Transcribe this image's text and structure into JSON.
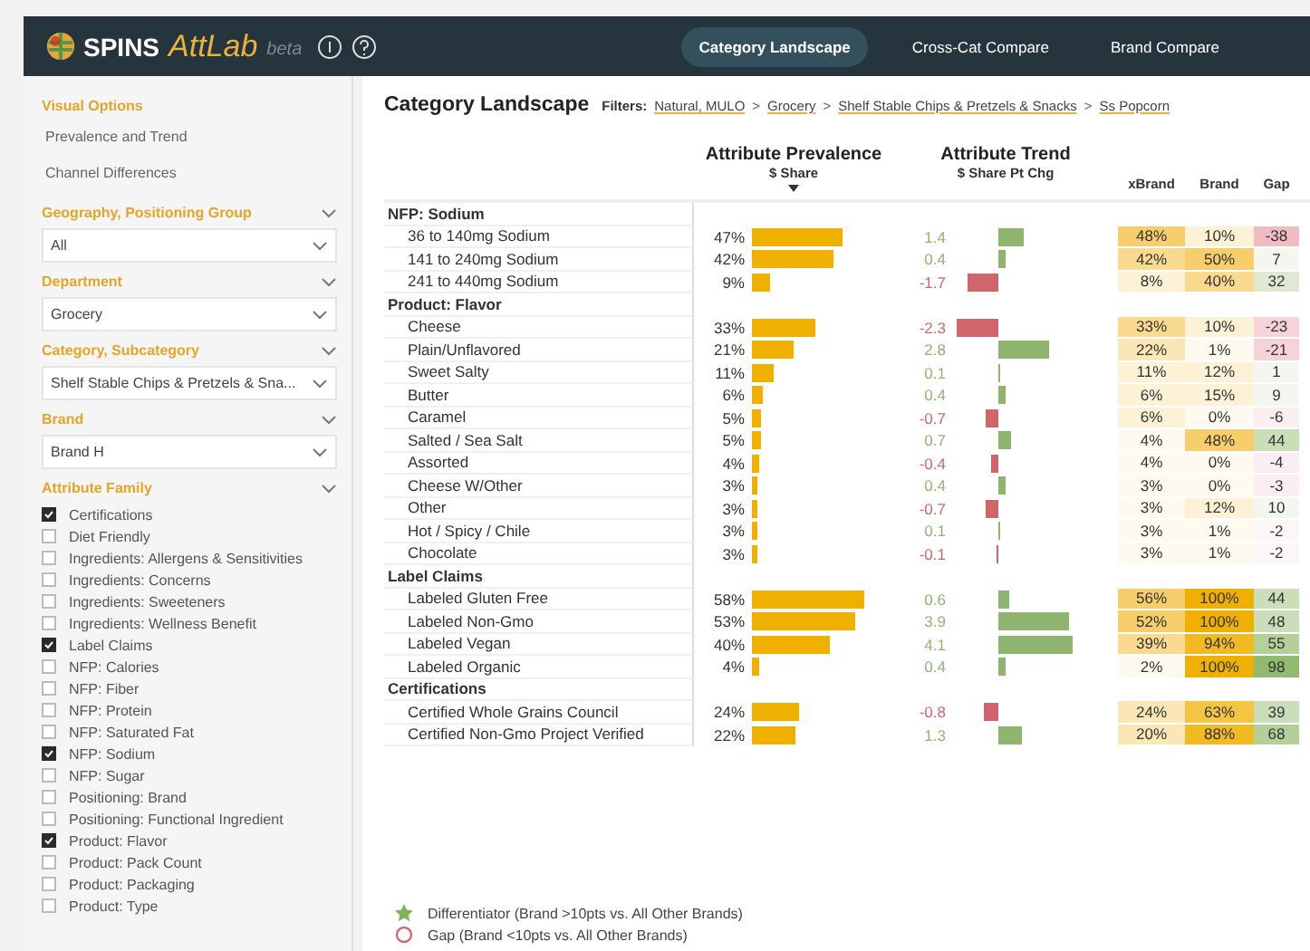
{
  "header": {
    "brand": "SPINS",
    "app_name": "AttLab",
    "badge": "beta",
    "tabs": [
      {
        "label": "Category Landscape",
        "selected": true
      },
      {
        "label": "Cross-Cat Compare",
        "selected": false
      },
      {
        "label": "Brand Compare",
        "selected": false
      }
    ]
  },
  "sidebar": {
    "visual_options": {
      "title": "Visual Options",
      "items": [
        "Prevalence and Trend",
        "Channel Differences"
      ]
    },
    "filters": [
      {
        "title": "Geography, Positioning Group",
        "value": "All"
      },
      {
        "title": "Department",
        "value": "Grocery"
      },
      {
        "title": "Category, Subcategory",
        "value": "Shelf Stable Chips & Pretzels & Sna..."
      },
      {
        "title": "Brand",
        "value": "Brand H"
      }
    ],
    "attribute_family": {
      "title": "Attribute Family",
      "items": [
        {
          "label": "Certifications",
          "checked": true
        },
        {
          "label": "Diet Friendly",
          "checked": false
        },
        {
          "label": "Ingredients: Allergens & Sensitivities",
          "checked": false
        },
        {
          "label": "Ingredients: Concerns",
          "checked": false
        },
        {
          "label": "Ingredients: Sweeteners",
          "checked": false
        },
        {
          "label": "Ingredients: Wellness Benefit",
          "checked": false
        },
        {
          "label": "Label Claims",
          "checked": true
        },
        {
          "label": "NFP: Calories",
          "checked": false
        },
        {
          "label": "NFP: Fiber",
          "checked": false
        },
        {
          "label": "NFP: Protein",
          "checked": false
        },
        {
          "label": "NFP: Saturated Fat",
          "checked": false
        },
        {
          "label": "NFP: Sodium",
          "checked": true
        },
        {
          "label": "NFP: Sugar",
          "checked": false
        },
        {
          "label": "Positioning: Brand",
          "checked": false
        },
        {
          "label": "Positioning: Functional Ingredient",
          "checked": false
        },
        {
          "label": "Product: Flavor",
          "checked": true
        },
        {
          "label": "Product: Pack Count",
          "checked": false
        },
        {
          "label": "Product: Packaging",
          "checked": false
        },
        {
          "label": "Product: Type",
          "checked": false
        }
      ]
    }
  },
  "main": {
    "title": "Category Landscape",
    "filters_label": "Filters:",
    "breadcrumbs": [
      {
        "label": "Natural, MULO"
      },
      {
        "separator": ">",
        "label": "Grocery"
      },
      {
        "separator": ">",
        "label": "Shelf Stable Chips & Pretzels & Snacks"
      },
      {
        "separator": ">",
        "label": "Ss Popcorn"
      }
    ],
    "table": {
      "columns": {
        "prevalence": {
          "title": "Attribute Prevalence",
          "subtitle": "$ Share"
        },
        "trend": {
          "title": "Attribute Trend",
          "subtitle": "$ Share Pt Chg"
        },
        "xbrand": "xBrand",
        "brand": "Brand",
        "gap": "Gap"
      },
      "groups": [
        {
          "title": "NFP: Sodium",
          "rows": [
            {
              "label": "36 to 140mg Sodium",
              "share": "47%",
              "trend": {
                "text": "1.4",
                "color": "#8fb46f"
              },
              "xbrand": {
                "text": "48%",
                "color": "#f6cf6c"
              },
              "brand": {
                "text": "10%",
                "color": "#fdf1d6"
              },
              "gap": {
                "text": "-38",
                "color": "#efbcc2"
              }
            },
            {
              "label": "141 to 240mg Sodium",
              "share": "42%",
              "trend": {
                "text": "0.4",
                "color": "#8fb46f"
              },
              "xbrand": {
                "text": "42%",
                "color": "#f9da8f"
              },
              "brand": {
                "text": "50%",
                "color": "#f6cf6c"
              },
              "gap": {
                "text": "7",
                "color": "#f3f7ef"
              }
            },
            {
              "label": "241 to 440mg Sodium",
              "share": "9%",
              "trend": {
                "text": "-1.7",
                "color": "#d0666c"
              },
              "xbrand": {
                "text": "8%",
                "color": "#fdf1d6"
              },
              "brand": {
                "text": "40%",
                "color": "#f9da8f"
              },
              "gap": {
                "text": "32",
                "color": "#dde9d3"
              }
            }
          ]
        },
        {
          "title": "Product: Flavor",
          "rows": [
            {
              "label": "Cheese",
              "share": "33%",
              "trend": {
                "text": "-2.3",
                "color": "#d0666c"
              },
              "xbrand": {
                "text": "33%",
                "color": "#f9da8f"
              },
              "brand": {
                "text": "10%",
                "color": "#fdf1d6"
              },
              "gap": {
                "text": "-23",
                "color": "#f5d3d7"
              }
            },
            {
              "label": "Plain/Unflavored",
              "share": "21%",
              "trend": {
                "text": "2.8",
                "color": "#8fb46f"
              },
              "xbrand": {
                "text": "22%",
                "color": "#fbe6b5"
              },
              "brand": {
                "text": "1%",
                "color": "#fffaf0"
              },
              "gap": {
                "text": "-21",
                "color": "#f5d3d7"
              }
            },
            {
              "label": "Sweet Salty",
              "share": "11%",
              "trend": {
                "text": "0.1",
                "color": "#8fb46f"
              },
              "xbrand": {
                "text": "11%",
                "color": "#fdf1d6"
              },
              "brand": {
                "text": "12%",
                "color": "#fdf1d6"
              },
              "gap": {
                "text": "1",
                "color": "#f3f7ef"
              }
            },
            {
              "label": "Butter",
              "share": "6%",
              "trend": {
                "text": "0.4",
                "color": "#8fb46f"
              },
              "xbrand": {
                "text": "6%",
                "color": "#fdf1d6"
              },
              "brand": {
                "text": "15%",
                "color": "#fdf1d6"
              },
              "gap": {
                "text": "9",
                "color": "#f3f7ef"
              }
            },
            {
              "label": "Caramel",
              "share": "5%",
              "trend": {
                "text": "-0.7",
                "color": "#d0666c"
              },
              "xbrand": {
                "text": "6%",
                "color": "#fdf1d6"
              },
              "brand": {
                "text": "0%",
                "color": "#fffaf0"
              },
              "gap": {
                "text": "-6",
                "color": "#fbeef0"
              }
            },
            {
              "label": "Salted / Sea Salt",
              "share": "5%",
              "trend": {
                "text": "0.7",
                "color": "#8fb46f"
              },
              "xbrand": {
                "text": "4%",
                "color": "#fffaf0"
              },
              "brand": {
                "text": "48%",
                "color": "#f6cf6c"
              },
              "gap": {
                "text": "44",
                "color": "#cadeb9"
              }
            },
            {
              "label": "Assorted",
              "share": "4%",
              "trend": {
                "text": "-0.4",
                "color": "#d0666c"
              },
              "xbrand": {
                "text": "4%",
                "color": "#fffaf0"
              },
              "brand": {
                "text": "0%",
                "color": "#fffaf0"
              },
              "gap": {
                "text": "-4",
                "color": "#fbeef0"
              }
            },
            {
              "label": "Cheese W/Other",
              "share": "3%",
              "trend": {
                "text": "0.4",
                "color": "#8fb46f"
              },
              "xbrand": {
                "text": "3%",
                "color": "#fffaf0"
              },
              "brand": {
                "text": "0%",
                "color": "#fffaf0"
              },
              "gap": {
                "text": "-3",
                "color": "#fbeef0"
              }
            },
            {
              "label": "Other",
              "share": "3%",
              "trend": {
                "text": "-0.7",
                "color": "#d0666c"
              },
              "xbrand": {
                "text": "3%",
                "color": "#fffaf0"
              },
              "brand": {
                "text": "12%",
                "color": "#fdf1d6"
              },
              "gap": {
                "text": "10",
                "color": "#f3f7ef"
              }
            },
            {
              "label": "Hot / Spicy / Chile",
              "share": "3%",
              "trend": {
                "text": "0.1",
                "color": "#8fb46f"
              },
              "xbrand": {
                "text": "3%",
                "color": "#fffaf0"
              },
              "brand": {
                "text": "1%",
                "color": "#fffaf0"
              },
              "gap": {
                "text": "-2",
                "color": "#fdf6f7"
              }
            },
            {
              "label": "Chocolate",
              "share": "3%",
              "trend": {
                "text": "-0.1",
                "color": "#d0666c"
              },
              "xbrand": {
                "text": "3%",
                "color": "#fffaf0"
              },
              "brand": {
                "text": "1%",
                "color": "#fffaf0"
              },
              "gap": {
                "text": "-2",
                "color": "#fdf6f7"
              }
            }
          ]
        },
        {
          "title": "Label Claims",
          "rows": [
            {
              "label": "Labeled Gluten Free",
              "share": "58%",
              "trend": {
                "text": "0.6",
                "color": "#8fb46f"
              },
              "xbrand": {
                "text": "56%",
                "color": "#f6cf6c"
              },
              "brand": {
                "text": "100%",
                "color": "#f0b000"
              },
              "gap": {
                "text": "44",
                "color": "#cadeb9"
              }
            },
            {
              "label": "Labeled Non-Gmo",
              "share": "53%",
              "trend": {
                "text": "3.9",
                "color": "#8fb46f"
              },
              "xbrand": {
                "text": "52%",
                "color": "#f6cf6c"
              },
              "brand": {
                "text": "100%",
                "color": "#f0b000"
              },
              "gap": {
                "text": "48",
                "color": "#cadeb9"
              }
            },
            {
              "label": "Labeled Vegan",
              "share": "40%",
              "trend": {
                "text": "4.1",
                "color": "#8fb46f"
              },
              "xbrand": {
                "text": "39%",
                "color": "#f9da8f"
              },
              "brand": {
                "text": "94%",
                "color": "#f2ba22"
              },
              "gap": {
                "text": "55",
                "color": "#b3d09a"
              }
            },
            {
              "label": "Labeled Organic",
              "share": "4%",
              "trend": {
                "text": "0.4",
                "color": "#8fb46f"
              },
              "xbrand": {
                "text": "2%",
                "color": "#fffaf0"
              },
              "brand": {
                "text": "100%",
                "color": "#f0b000"
              },
              "gap": {
                "text": "98",
                "color": "#8fba6f"
              }
            }
          ]
        },
        {
          "title": "Certifications",
          "rows": [
            {
              "label": "Certified Whole Grains Council",
              "share": "24%",
              "trend": {
                "text": "-0.8",
                "color": "#d0666c"
              },
              "xbrand": {
                "text": "24%",
                "color": "#fbe6b5"
              },
              "brand": {
                "text": "63%",
                "color": "#f4c443"
              },
              "gap": {
                "text": "39",
                "color": "#cadeb9"
              }
            },
            {
              "label": "Certified Non-Gmo Project Verified",
              "share": "22%",
              "trend": {
                "text": "1.3",
                "color": "#8fb46f"
              },
              "xbrand": {
                "text": "20%",
                "color": "#fbe6b5"
              },
              "brand": {
                "text": "88%",
                "color": "#f2ba22"
              },
              "gap": {
                "text": "68",
                "color": "#b3d09a"
              }
            }
          ]
        }
      ]
    },
    "legend": [
      {
        "kind": "star",
        "label": "Differentiator (Brand >10pts vs. All Other Brands)"
      },
      {
        "kind": "circle",
        "label": "Gap (Brand <10pts vs. All Other Brands)"
      }
    ]
  }
}
